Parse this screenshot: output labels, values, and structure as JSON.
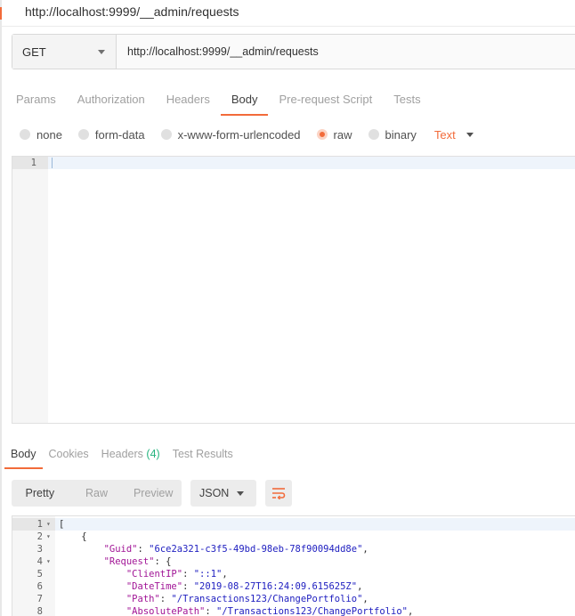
{
  "request": {
    "title": "http://localhost:9999/__admin/requests",
    "method": "GET",
    "url": "http://localhost:9999/__admin/requests",
    "tabs": [
      {
        "label": "Params"
      },
      {
        "label": "Authorization"
      },
      {
        "label": "Headers"
      },
      {
        "label": "Body"
      },
      {
        "label": "Pre-request Script"
      },
      {
        "label": "Tests"
      }
    ],
    "active_tab": "Body",
    "body_types": [
      {
        "label": "none"
      },
      {
        "label": "form-data"
      },
      {
        "label": "x-www-form-urlencoded"
      },
      {
        "label": "raw"
      },
      {
        "label": "binary"
      }
    ],
    "selected_body_type": "raw",
    "raw_format": "Text",
    "editor_line": "1"
  },
  "response": {
    "tabs": [
      {
        "label": "Body"
      },
      {
        "label": "Cookies"
      },
      {
        "label": "Headers",
        "count": "(4)"
      },
      {
        "label": "Test Results"
      }
    ],
    "active_tab": "Body",
    "view_modes": [
      {
        "label": "Pretty"
      },
      {
        "label": "Raw"
      },
      {
        "label": "Preview"
      }
    ],
    "active_view": "Pretty",
    "format": "JSON",
    "wrap_icon": "wrap-lines-icon",
    "lines": [
      {
        "num": "1",
        "fold": "▾",
        "indent": "",
        "open": "[",
        "key": "",
        "value": "",
        "end": ""
      },
      {
        "num": "2",
        "fold": "▾",
        "indent": "    ",
        "open": "{",
        "key": "",
        "value": "",
        "end": ""
      },
      {
        "num": "3",
        "fold": "",
        "indent": "        ",
        "open": "",
        "key": "\"Guid\"",
        "value": "\"6ce2a321-c3f5-49bd-98eb-78f90094dd8e\"",
        "end": ","
      },
      {
        "num": "4",
        "fold": "▾",
        "indent": "        ",
        "open": "",
        "key": "\"Request\"",
        "value": "",
        "end": "{"
      },
      {
        "num": "5",
        "fold": "",
        "indent": "            ",
        "open": "",
        "key": "\"ClientIP\"",
        "value": "\"::1\"",
        "end": ","
      },
      {
        "num": "6",
        "fold": "",
        "indent": "            ",
        "open": "",
        "key": "\"DateTime\"",
        "value": "\"2019-08-27T16:24:09.615625Z\"",
        "end": ","
      },
      {
        "num": "7",
        "fold": "",
        "indent": "            ",
        "open": "",
        "key": "\"Path\"",
        "value": "\"/Transactions123/ChangePortfolio\"",
        "end": ","
      },
      {
        "num": "8",
        "fold": "",
        "indent": "            ",
        "open": "",
        "key": "\"AbsolutePath\"",
        "value": "\"/Transactions123/ChangePortfolio\"",
        "end": ","
      }
    ]
  },
  "colors": {
    "accent": "#f26b3a",
    "count_green": "#26b47f",
    "json_key": "#a11596",
    "json_string": "#2020c0"
  }
}
